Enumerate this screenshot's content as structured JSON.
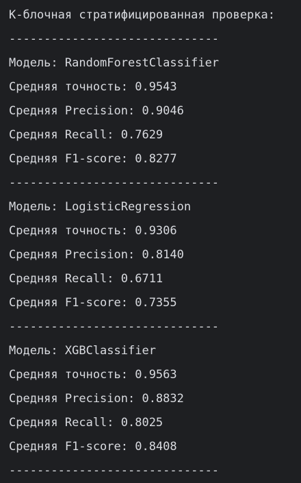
{
  "console": {
    "lines": [
      "К-блочная стратифицированная проверка:",
      "------------------------------",
      "Модель: RandomForestClassifier",
      "Средняя точность: 0.9543",
      "Средняя Precision: 0.9046",
      "Средняя Recall: 0.7629",
      "Средняя F1-score: 0.8277",
      "------------------------------",
      "Модель: LogisticRegression",
      "Средняя точность: 0.9306",
      "Средняя Precision: 0.8140",
      "Средняя Recall: 0.6711",
      "Средняя F1-score: 0.7355",
      "------------------------------",
      "Модель: XGBClassifier",
      "Средняя точность: 0.9563",
      "Средняя Precision: 0.8832",
      "Средняя Recall: 0.8025",
      "Средняя F1-score: 0.8408",
      "------------------------------"
    ]
  }
}
